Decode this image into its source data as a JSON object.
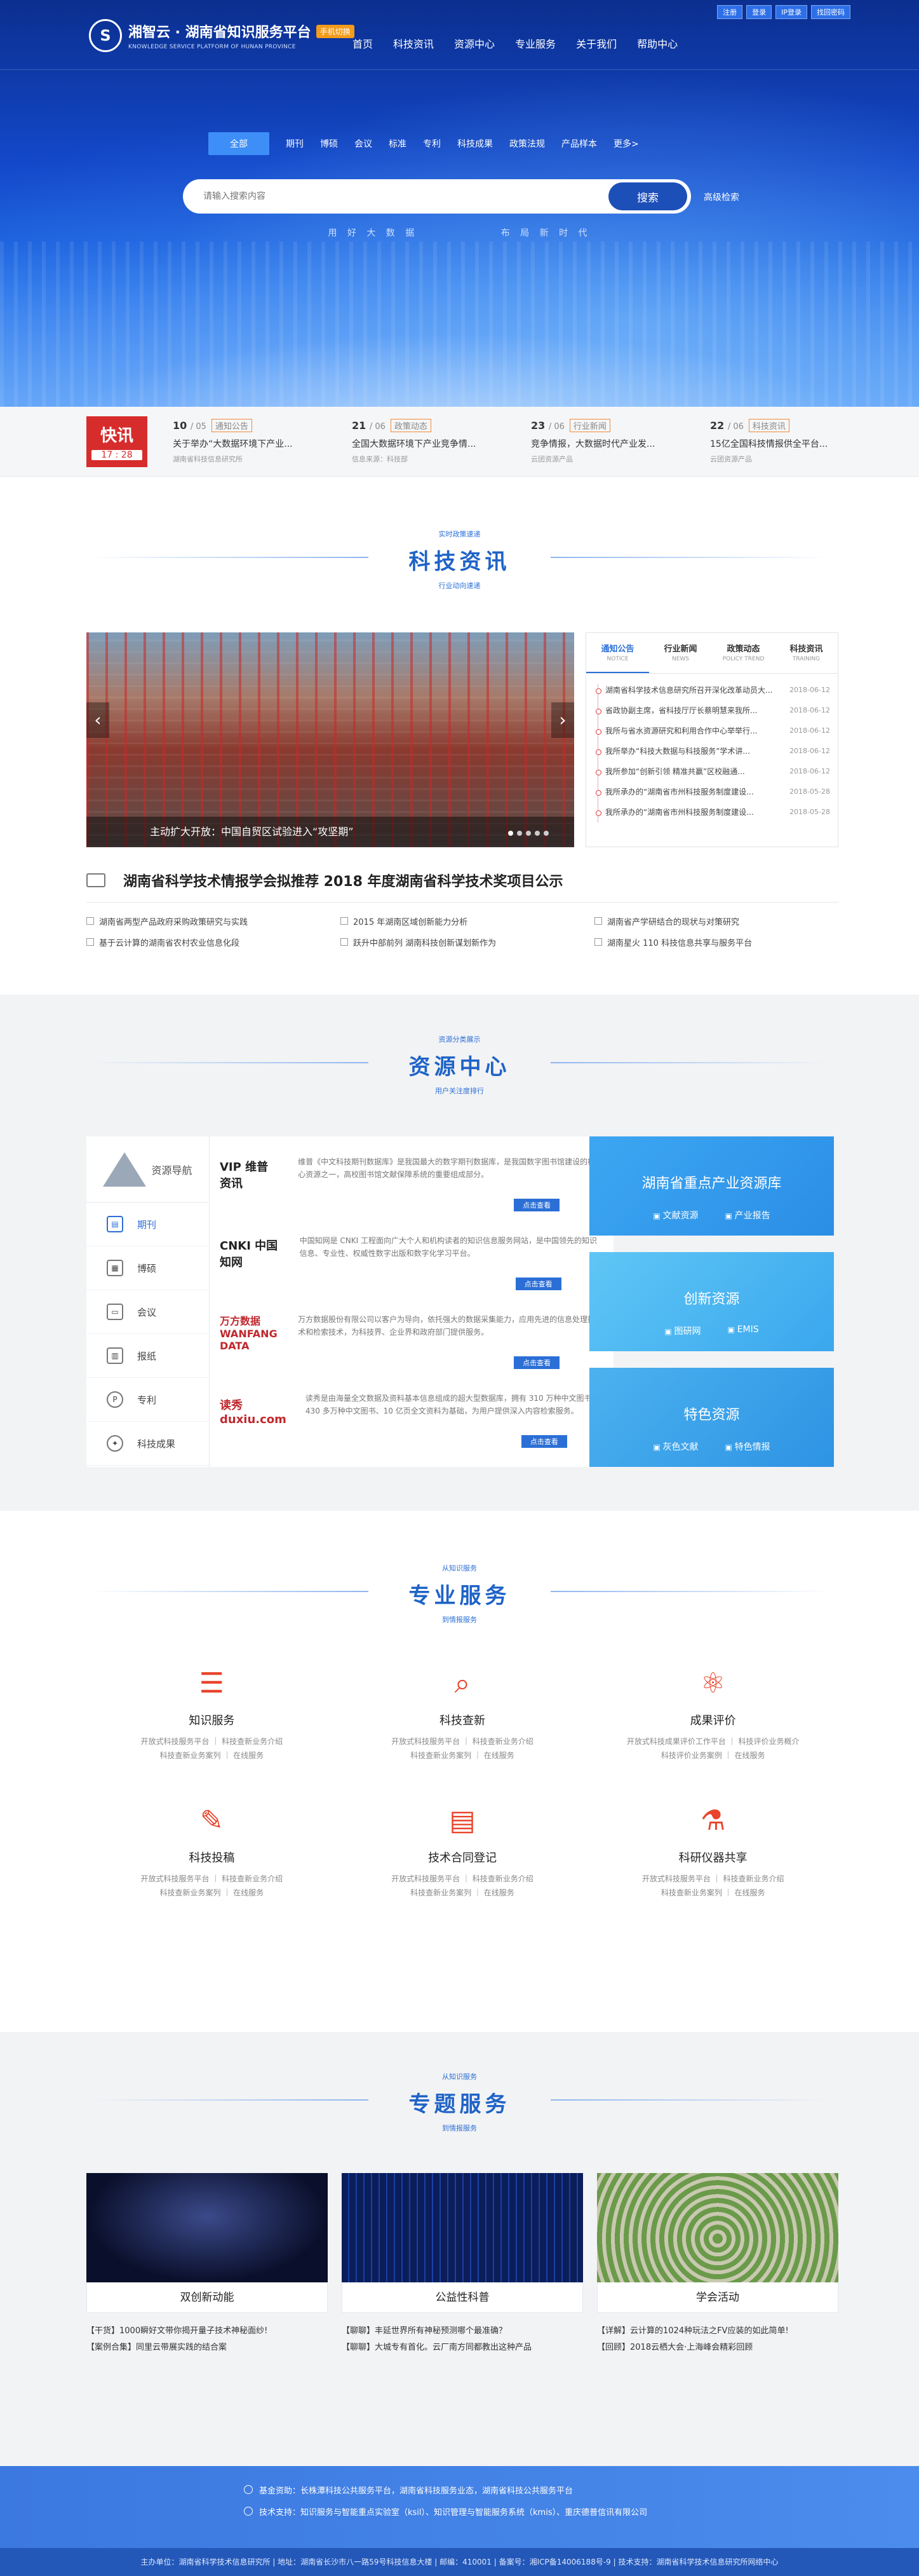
{
  "header": {
    "logo_text": "湘智云 · 湖南省知识服务平台",
    "logo_badge": "手机切换",
    "logo_sub": "KNOWLEDGE SERVICE PLATFORM OF HUNAN PROVINCE",
    "toplinks": [
      "注册",
      "登录",
      "IP登录",
      "找回密码"
    ],
    "nav": [
      "首页",
      "科技资讯",
      "资源中心",
      "专业服务",
      "关于我们",
      "帮助中心"
    ]
  },
  "search": {
    "categories": [
      "全部",
      "期刊",
      "博硕",
      "会议",
      "标准",
      "专利",
      "科技成果",
      "政策法规",
      "产品样本",
      "更多>"
    ],
    "placeholder": "请输入搜索内容",
    "button": "搜索",
    "advanced": "高级检索",
    "slogan": [
      "用 好 大 数 据",
      "布 局 新 时 代"
    ]
  },
  "flash": {
    "label": "快讯",
    "time": "17 : 28",
    "items": [
      {
        "day": "10",
        "month": "/ 05",
        "tag": "通知公告",
        "title": "关于举办“大数据环境下产业...",
        "source": "湖南省科技信息研究所"
      },
      {
        "day": "21",
        "month": "/ 06",
        "tag": "政策动态",
        "title": "全国大数据环境下产业竞争情...",
        "source": "信息来源：科技部"
      },
      {
        "day": "23",
        "month": "/ 06",
        "tag": "行业新闻",
        "title": "竞争情报，大数据时代产业发...",
        "source": "云团资源产品"
      },
      {
        "day": "22",
        "month": "/ 06",
        "tag": "科技资讯",
        "title": "15亿全国科技情报供全平台...",
        "source": "云团资源产品"
      }
    ]
  },
  "news_section": {
    "small_top": "实时政策速递",
    "title": "科技资讯",
    "small_bottom": "行业动向速递",
    "carousel_caption": "主动扩大开放：中国自贸区试验进入“攻坚期”",
    "tabs": [
      {
        "label": "通知公告",
        "en": "NOTICE"
      },
      {
        "label": "行业新闻",
        "en": "NEWS"
      },
      {
        "label": "政策动态",
        "en": "POLICY TREND"
      },
      {
        "label": "科技资讯",
        "en": "TRAINING"
      }
    ],
    "list": [
      {
        "title": "湖南省科学技术信息研究所召开深化改革动员大...",
        "date": "2018-06-12"
      },
      {
        "title": "省政协副主席，省科技厅厅长蔡明慧来我所...",
        "date": "2018-06-12"
      },
      {
        "title": "我所与省水资源研究和利用合作中心举举行...",
        "date": "2018-06-12"
      },
      {
        "title": "我所举办“科技大数据与科技服务”学术讲...",
        "date": "2018-06-12"
      },
      {
        "title": "我所参加“创新引领 精准共赢”区校融通...",
        "date": "2018-06-12"
      },
      {
        "title": "我所承办的“湖南省市州科技服务制度建设...",
        "date": "2018-05-28"
      },
      {
        "title": "我所承办的“湖南省市州科技服务制度建设...",
        "date": "2018-05-28"
      }
    ],
    "headline": "湖南省科学技术情报学会拟推荐 2018 年度湖南省科学技术奖项目公示",
    "sublinks": [
      "湖南省两型产品政府采购政策研究与实践",
      "2015 年湖南区域创新能力分析",
      "湖南省产学研结合的现状与对策研究",
      "基于云计算的湖南省农村农业信息化段",
      "跃升中部前列 湖南科技创新谋划新作为",
      "湖南星火 110 科技信息共享与服务平台"
    ]
  },
  "resource_section": {
    "small_top": "资源分类展示",
    "title": "资源中心",
    "small_bottom": "用户关注度排行",
    "nav_title": "资源导航",
    "nav_items": [
      "期刊",
      "博硕",
      "会议",
      "报纸",
      "专利",
      "科技成果"
    ],
    "providers": [
      {
        "brand": "VIP 维普资讯",
        "desc": "维普《中文科技期刊数据库》是我国最大的数字期刊数据库，是我国数字图书馆建设的核心资源之一，高校图书馆文献保障系统的重要组成部分。",
        "btn": "点击查看"
      },
      {
        "brand": "CNKI 中国知网",
        "desc": "中国知网是 CNKI 工程面向广大个人和机构读者的知识信息服务网站，是中国领先的知识信息、专业性、权威性数字出版和数字化学习平台。",
        "btn": "点击查看"
      },
      {
        "brand": "万方数据 WANFANG DATA",
        "desc": "万方数据股份有限公司以客户为导向，依托强大的数据采集能力，应用先进的信息处理技术和检索技术，为科技界、企业界和政府部门提供服务。",
        "btn": "点击查看"
      },
      {
        "brand": "读秀 duxiu.com",
        "desc": "读秀是由海量全文数据及资料基本信息组成的超大型数据库，拥有 310 万种中文图书，430 多万种中文图书、10 亿页全文资料为基础，为用户提供深入内容检索服务。",
        "btn": "点击查看"
      }
    ],
    "cards": [
      {
        "title": "湖南省重点产业资源库",
        "tags": [
          "文献资源",
          "产业报告"
        ]
      },
      {
        "title": "创新资源",
        "tags": [
          "图研网",
          "EMIS"
        ]
      },
      {
        "title": "特色资源",
        "tags": [
          "灰色文献",
          "特色情报"
        ]
      }
    ]
  },
  "service_section": {
    "small_top": "从知识服务",
    "title": "专业服务",
    "small_bottom": "到情报服务",
    "items": [
      {
        "icon": "book-stack-icon",
        "title": "知识服务",
        "lines": [
          "开放式科技服务平台 ｜ 科技查新业务介绍",
          "科技查新业务案列 ｜ 在线服务"
        ]
      },
      {
        "icon": "search-document-icon",
        "title": "科技查新",
        "lines": [
          "开放式科技服务平台 ｜ 科技查新业务介绍",
          "科技查新业务案列 ｜ 在线服务"
        ]
      },
      {
        "icon": "atom-icon",
        "title": "成果评价",
        "lines": [
          "开放式科技成果评价工作平台 ｜ 科技评价业务概介",
          "科技评价业务案例 ｜ 在线服务"
        ]
      },
      {
        "icon": "pen-icon",
        "title": "科技投稿",
        "lines": [
          "开放式科技服务平台 ｜ 科技查新业务介绍",
          "科技查新业务案列 ｜ 在线服务"
        ]
      },
      {
        "icon": "contract-icon",
        "title": "技术合同登记",
        "lines": [
          "开放式科技服务平台 ｜ 科技查新业务介绍",
          "科技查新业务案列 ｜ 在线服务"
        ]
      },
      {
        "icon": "microscope-icon",
        "title": "科研仪器共享",
        "lines": [
          "开放式科技服务平台 ｜ 科技查新业务介绍",
          "科技查新业务案列 ｜ 在线服务"
        ]
      }
    ]
  },
  "topic_section": {
    "small_top": "从知识服务",
    "title": "专题服务",
    "small_bottom": "到情报服务",
    "topics": [
      {
        "caption": "双创新动能",
        "links": [
          "【干货】1000瞬好文带你揭开量子技术神秘面纱!",
          "【案例合集】同里云带展实践的结合案"
        ]
      },
      {
        "caption": "公益性科普",
        "links": [
          "【聊聊】丰延世界所有神秘预测哪个最准确？",
          "【聊聊】大城专有首化。云厂南方同都教出这种产品"
        ]
      },
      {
        "caption": "学会活动",
        "links": [
          "【详解】云计算的1024种玩法之FV应装的如此简单!",
          "【回顾】2018云栖大会·上海峰会精彩回顾"
        ]
      }
    ]
  },
  "footer": {
    "lines": [
      "基金资助：长株潭科技公共服务平台，湖南省科技服务业态，湖南省科技公共服务平台",
      "技术支持：知识服务与智能重点实验室（ksil）、知识管理与智能服务系统（kmis）、重庆德普信讯有限公司"
    ],
    "bottom": "主办单位：湖南省科学技术信息研究所 | 地址：湖南省长沙市八一路59号科技信息大楼 | 邮编：410001 | 备案号：湘ICP备14006188号-9 | 技术支持：湖南省科学技术信息研究所网络中心"
  }
}
